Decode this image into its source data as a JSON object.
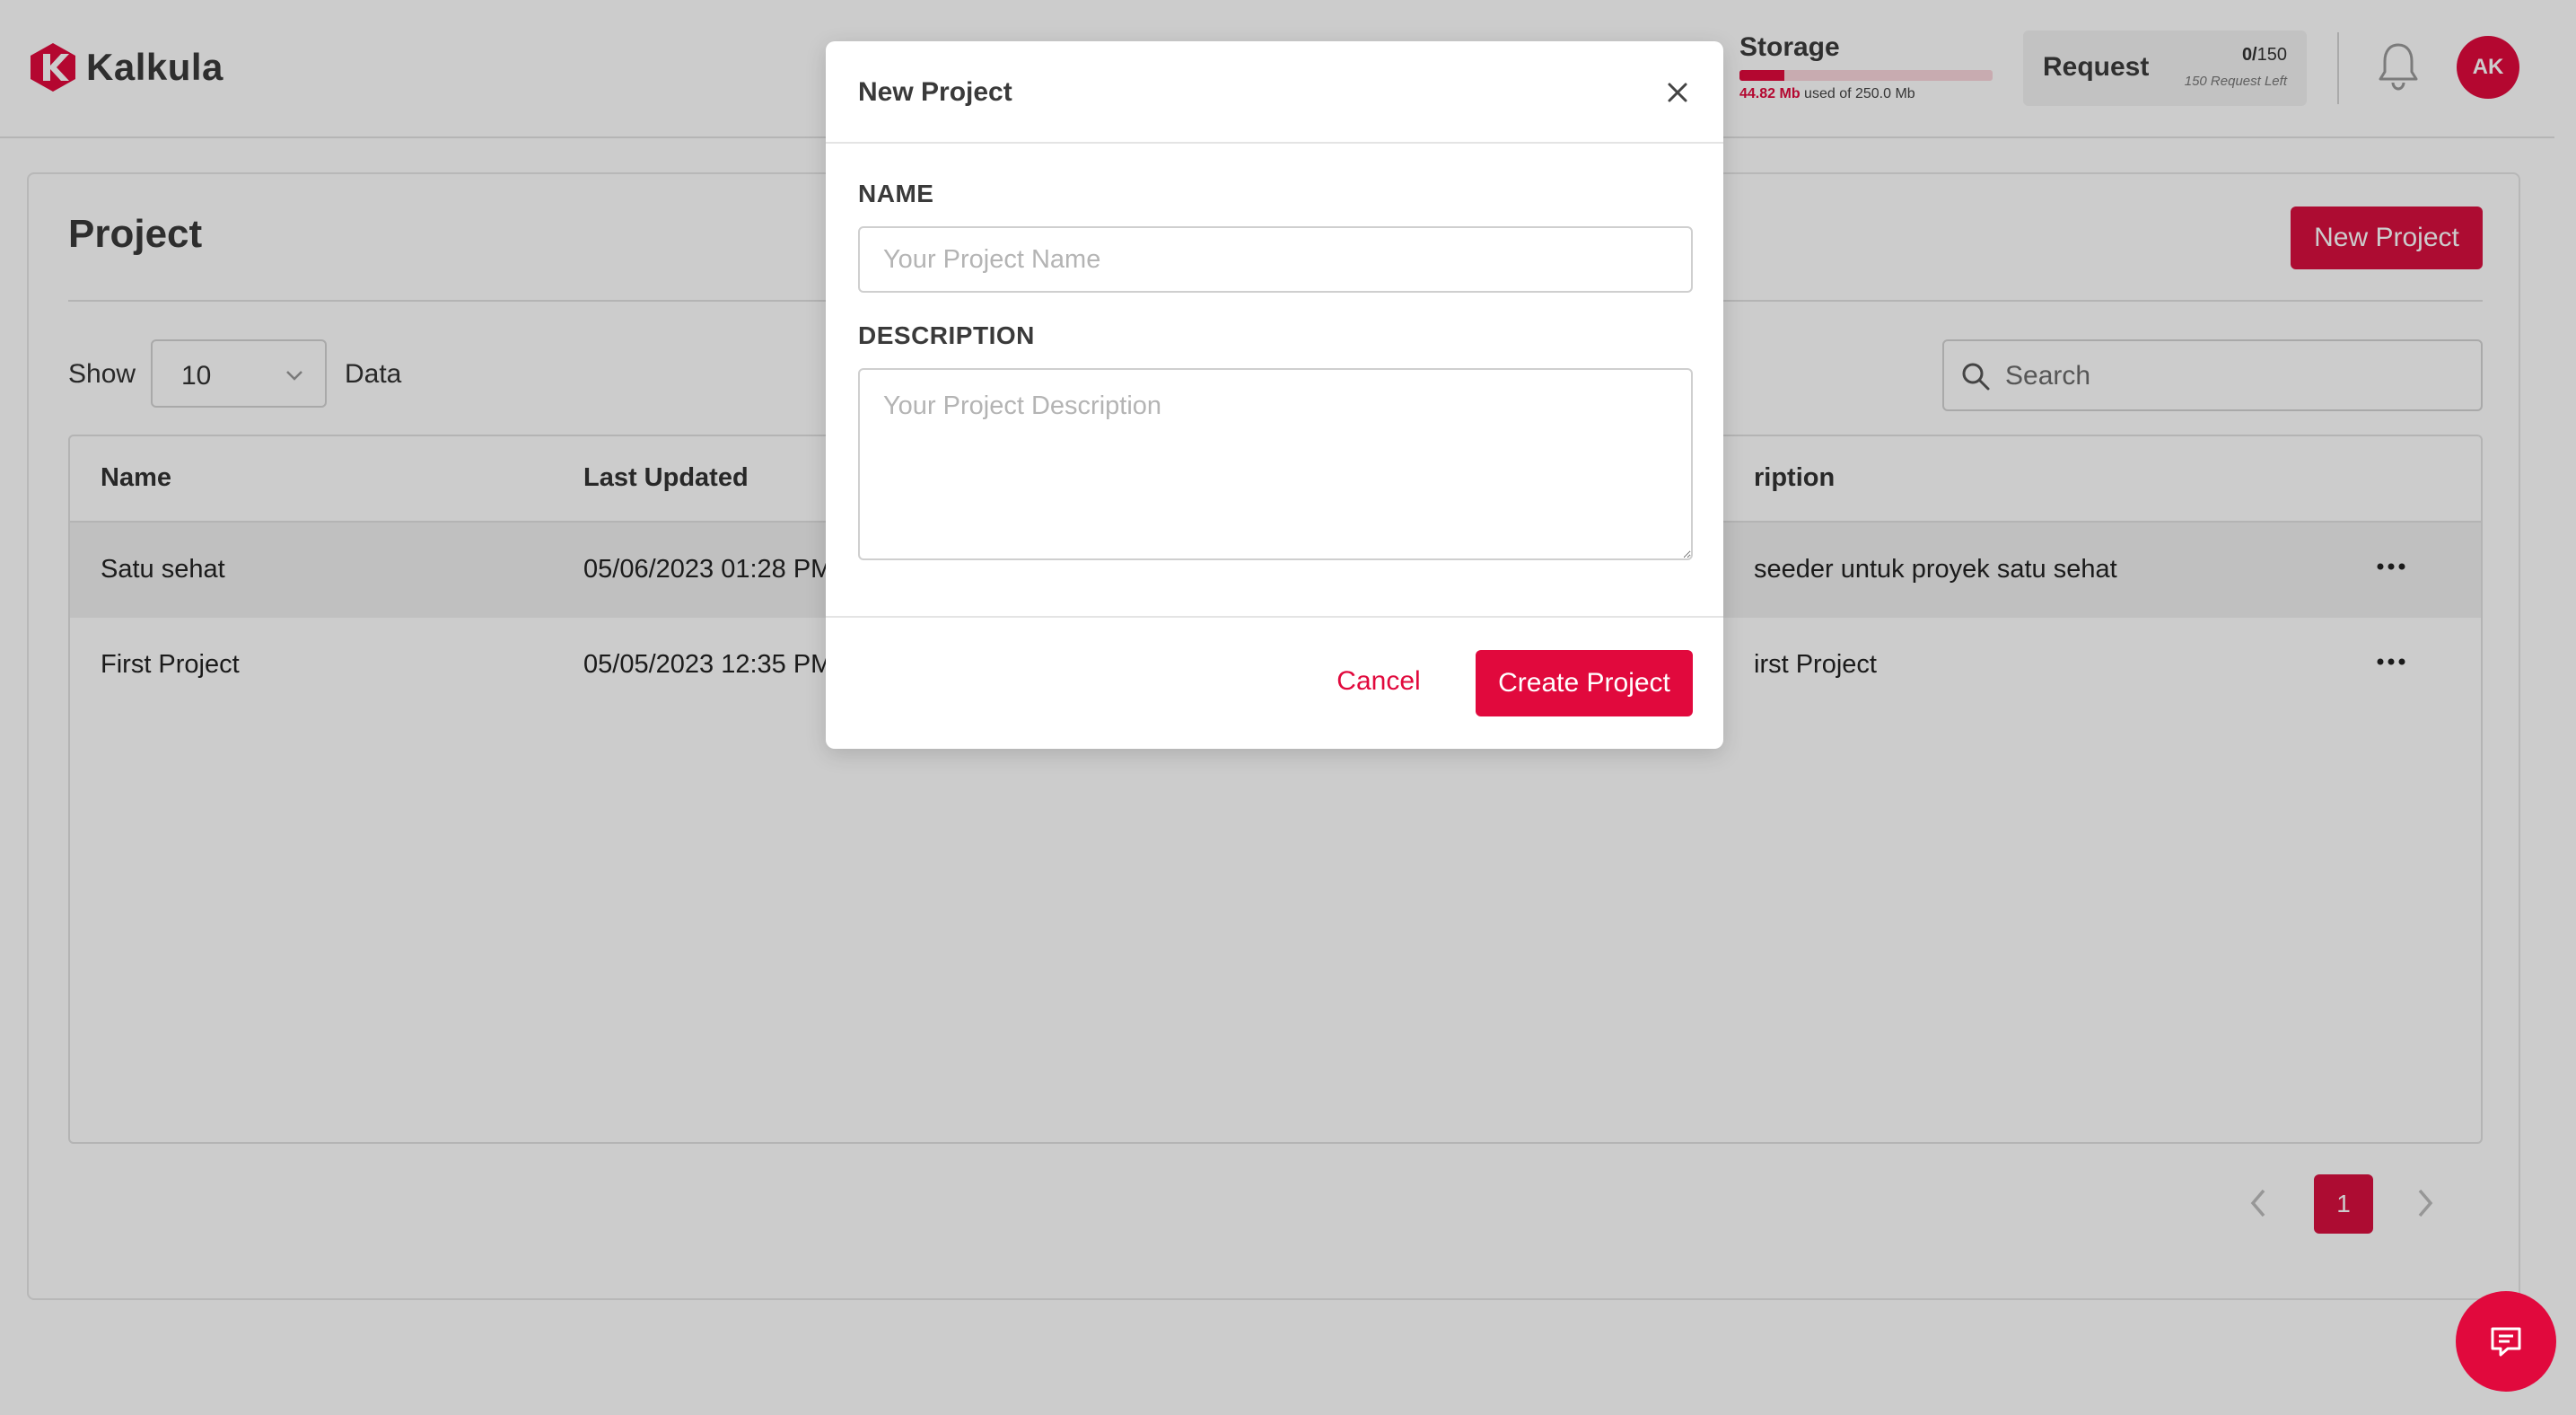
{
  "app": {
    "name": "Kalkula"
  },
  "header": {
    "storage": {
      "title": "Storage",
      "used": "44.82 Mb",
      "used_suffix": "used of 250.0 Mb",
      "percent_used": 17.9
    },
    "request": {
      "label": "Request",
      "count_used": "0/",
      "count_total": "150",
      "left_text": "150 Request Left"
    },
    "avatar_initials": "AK",
    "icons": {
      "notifications": "bell-icon",
      "chat": "chat-icon"
    }
  },
  "page": {
    "title": "Project",
    "new_button": "New Project",
    "show_label": "Show",
    "show_value": "10",
    "data_label": "Data",
    "search_placeholder": "Search"
  },
  "table": {
    "columns": {
      "name": "Name",
      "last_updated": "Last Updated",
      "description": "ription"
    },
    "rows": [
      {
        "name": "Satu sehat",
        "last_updated": "05/06/2023 01:28 PM",
        "description": "seeder untuk proyek satu sehat"
      },
      {
        "name": "First Project",
        "last_updated": "05/05/2023 12:35 PM",
        "description": "irst Project"
      }
    ]
  },
  "pagination": {
    "current": "1"
  },
  "modal": {
    "title": "New Project",
    "name_label": "NAME",
    "name_placeholder": "Your Project Name",
    "description_label": "DESCRIPTION",
    "description_placeholder": "Your Project Description",
    "cancel_label": "Cancel",
    "create_label": "Create Project"
  },
  "colors": {
    "accent": "#e1093d",
    "button": "#d90f3f"
  }
}
